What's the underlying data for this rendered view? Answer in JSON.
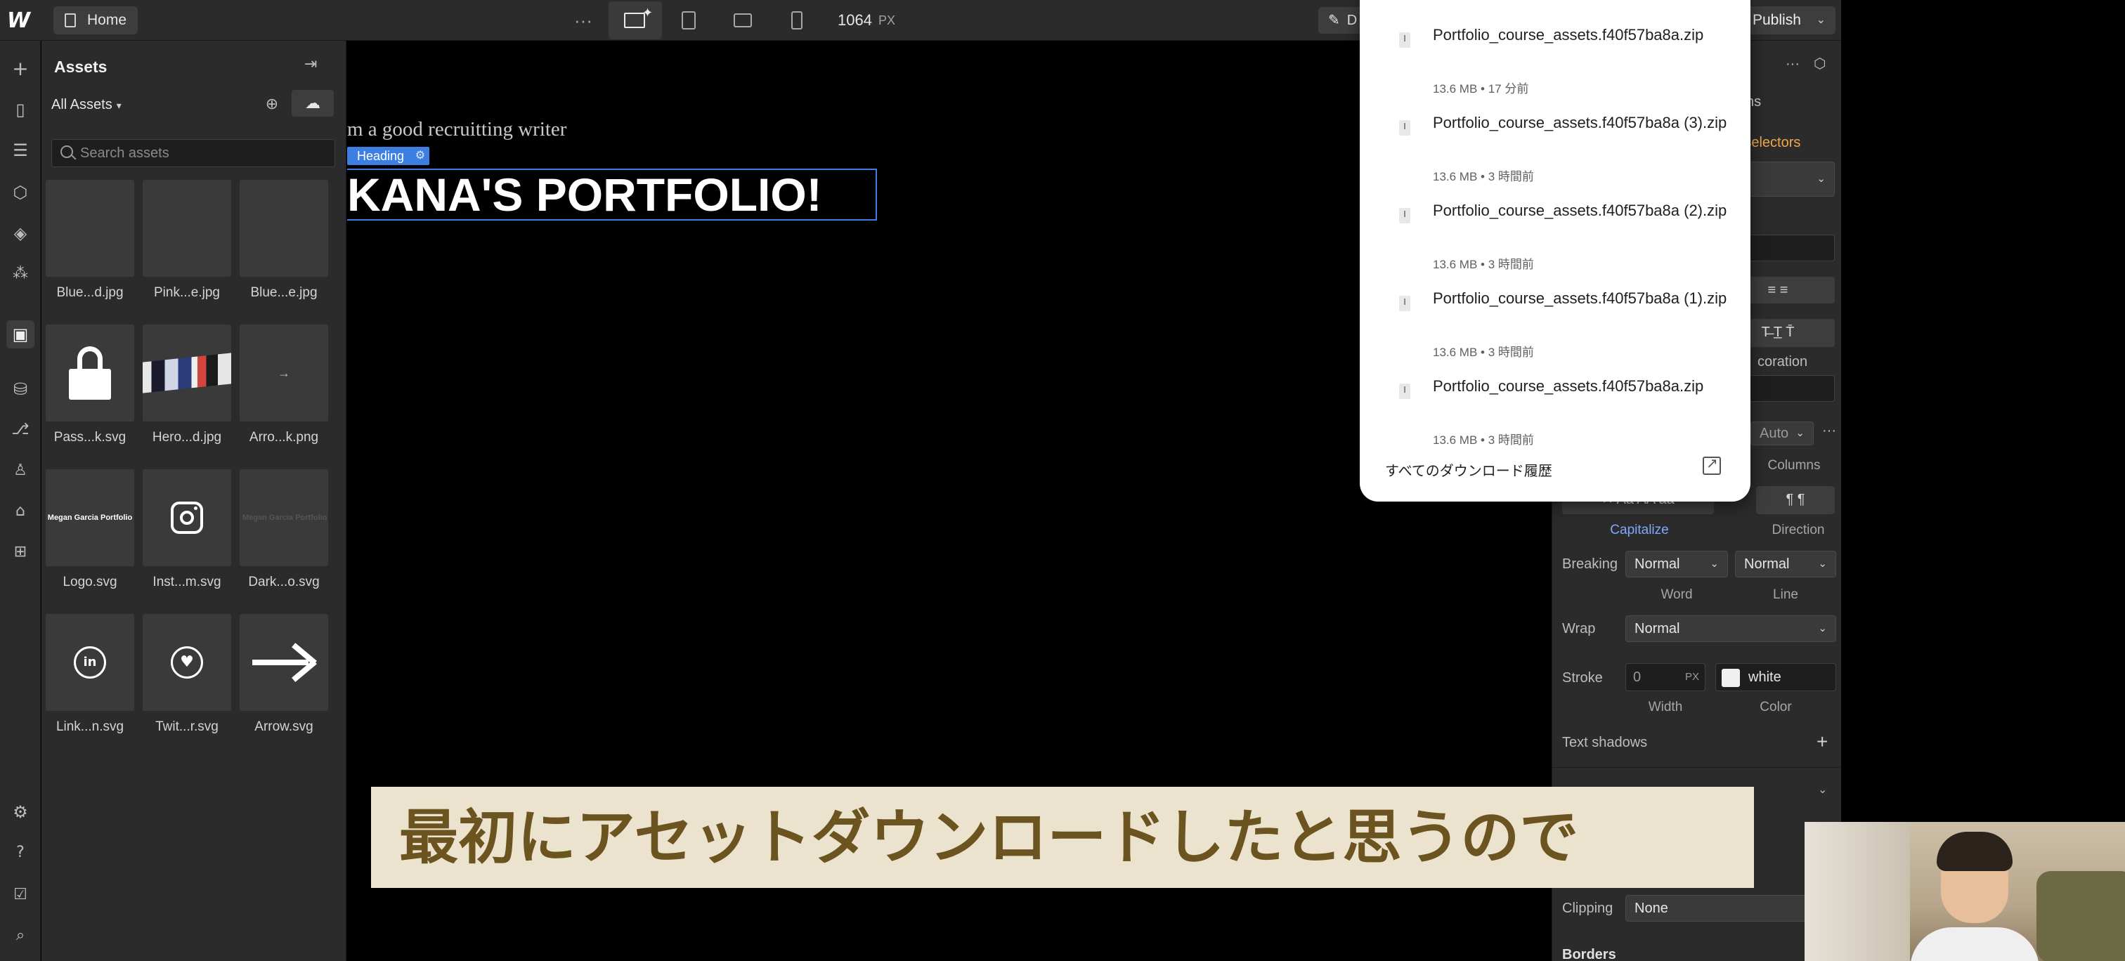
{
  "topbar": {
    "logo": "W",
    "home_label": "Home",
    "more_label": "···",
    "width_value": "1064",
    "width_unit": "PX",
    "design_label": "D",
    "publish_label": "Publish"
  },
  "assets_panel": {
    "title": "Assets",
    "filter_label": "All Assets",
    "search_placeholder": "Search assets",
    "items": [
      {
        "name": "Blue...d.jpg"
      },
      {
        "name": "Pink...e.jpg"
      },
      {
        "name": "Blue...e.jpg"
      },
      {
        "name": "Pass...k.svg"
      },
      {
        "name": "Hero...d.jpg"
      },
      {
        "name": "Arro...k.png"
      },
      {
        "name": "Logo.svg"
      },
      {
        "name": "Inst...m.svg"
      },
      {
        "name": "Dark...o.svg"
      },
      {
        "name": "Link...n.svg"
      },
      {
        "name": "Twit...r.svg"
      },
      {
        "name": "Arrow.svg"
      }
    ],
    "logo_thumb_text": "Megan Garcia Portfolio",
    "dark_thumb_text_a": "Megan Garcia",
    "dark_thumb_text_b": "Portfolio",
    "linkedin_glyph": "in"
  },
  "canvas": {
    "subtitle": "m a good  recruitting writer",
    "heading_tag": "Heading",
    "heading_text": "KANA'S PORTFOLIO!"
  },
  "downloads": {
    "items": [
      {
        "filename": "Portfolio_course_assets.f40f57ba8a.zip",
        "meta": "13.6 MB • 17 分前"
      },
      {
        "filename": "Portfolio_course_assets.f40f57ba8a (3).zip",
        "meta": "13.6 MB • 3 時間前"
      },
      {
        "filename": "Portfolio_course_assets.f40f57ba8a (2).zip",
        "meta": "13.6 MB • 3 時間前"
      },
      {
        "filename": "Portfolio_course_assets.f40f57ba8a (1).zip",
        "meta": "13.6 MB • 3 時間前"
      },
      {
        "filename": "Portfolio_course_assets.f40f57ba8a.zip",
        "meta": "13.6 MB • 3 時間前"
      }
    ],
    "history_label": "すべてのダウンロード履歴"
  },
  "style_panel": {
    "tab_partial": "ns",
    "selectors_text": "g 2 selectors",
    "decoration_partial": "coration",
    "auto_label": "Auto",
    "columns_label": "Columns",
    "capitalize_label": "Capitalize",
    "direction_label": "Direction",
    "breaking_label": "Breaking",
    "breaking_word_value": "Normal",
    "breaking_line_value": "Normal",
    "word_label": "Word",
    "line_label": "Line",
    "wrap_label": "Wrap",
    "wrap_value": "Normal",
    "stroke_label": "Stroke",
    "stroke_width_value": "0",
    "stroke_width_unit": "PX",
    "stroke_color_value": "white",
    "width_label": "Width",
    "color_label": "Color",
    "text_shadows_label": "Text shadows",
    "clipping_label": "Clipping",
    "clipping_value": "None",
    "borders_label": "Borders"
  },
  "caption": {
    "text": "最初にアセットダウンロードしたと思うので"
  }
}
